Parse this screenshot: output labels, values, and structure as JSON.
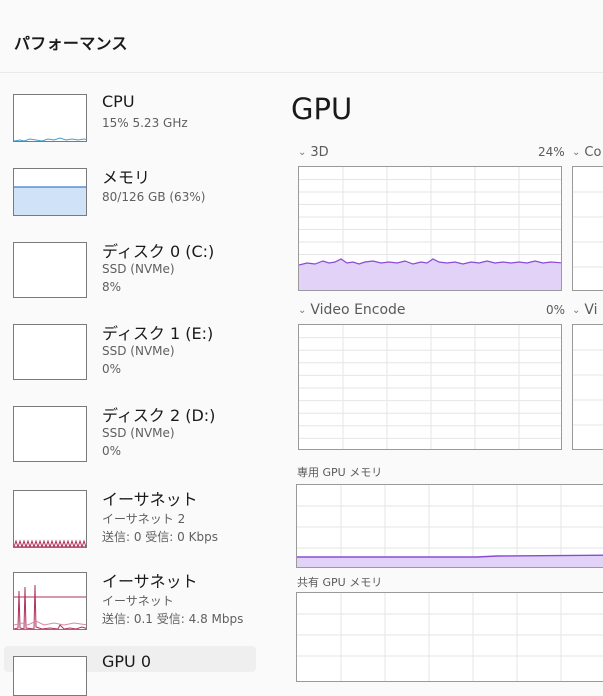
{
  "header": {
    "title": "パフォーマンス"
  },
  "sidebar": {
    "items": [
      {
        "name": "CPU",
        "sub1": "15%  5.23 GHz",
        "sub2": "",
        "sub3": ""
      },
      {
        "name": "メモリ",
        "sub1": "80/126 GB (63%)",
        "sub2": "",
        "sub3": ""
      },
      {
        "name": "ディスク 0 (C:)",
        "sub1": "SSD (NVMe)",
        "sub2": "8%",
        "sub3": ""
      },
      {
        "name": "ディスク 1 (E:)",
        "sub1": "SSD (NVMe)",
        "sub2": "0%",
        "sub3": ""
      },
      {
        "name": "ディスク 2 (D:)",
        "sub1": "SSD (NVMe)",
        "sub2": "0%",
        "sub3": ""
      },
      {
        "name": "イーサネット",
        "sub1": "イーサネット 2",
        "sub2": "送信: 0 受信: 0 Kbps",
        "sub3": ""
      },
      {
        "name": "イーサネット",
        "sub1": "イーサネット",
        "sub2": "送信: 0.1 受信: 4.8 Mbps",
        "sub3": ""
      },
      {
        "name": "GPU 0",
        "sub1": "",
        "sub2": "",
        "sub3": ""
      }
    ]
  },
  "gpu": {
    "heading": "GPU",
    "engines": [
      {
        "label": "3D",
        "percent": "24%",
        "next_label": "Co"
      },
      {
        "label": "Video Encode",
        "percent": "0%",
        "next_label": "Vi"
      }
    ],
    "dedicated_label": "専用 GPU メモリ",
    "shared_label": "共有 GPU メモリ"
  },
  "colors": {
    "cpu": "#4b9cd3",
    "memory": "#3c7fc3",
    "memory_fill": "#cfe2f7",
    "ethernet": "#b0325a",
    "gpu_line": "#8a4ad8",
    "gpu_fill": "#e3d2f7"
  }
}
